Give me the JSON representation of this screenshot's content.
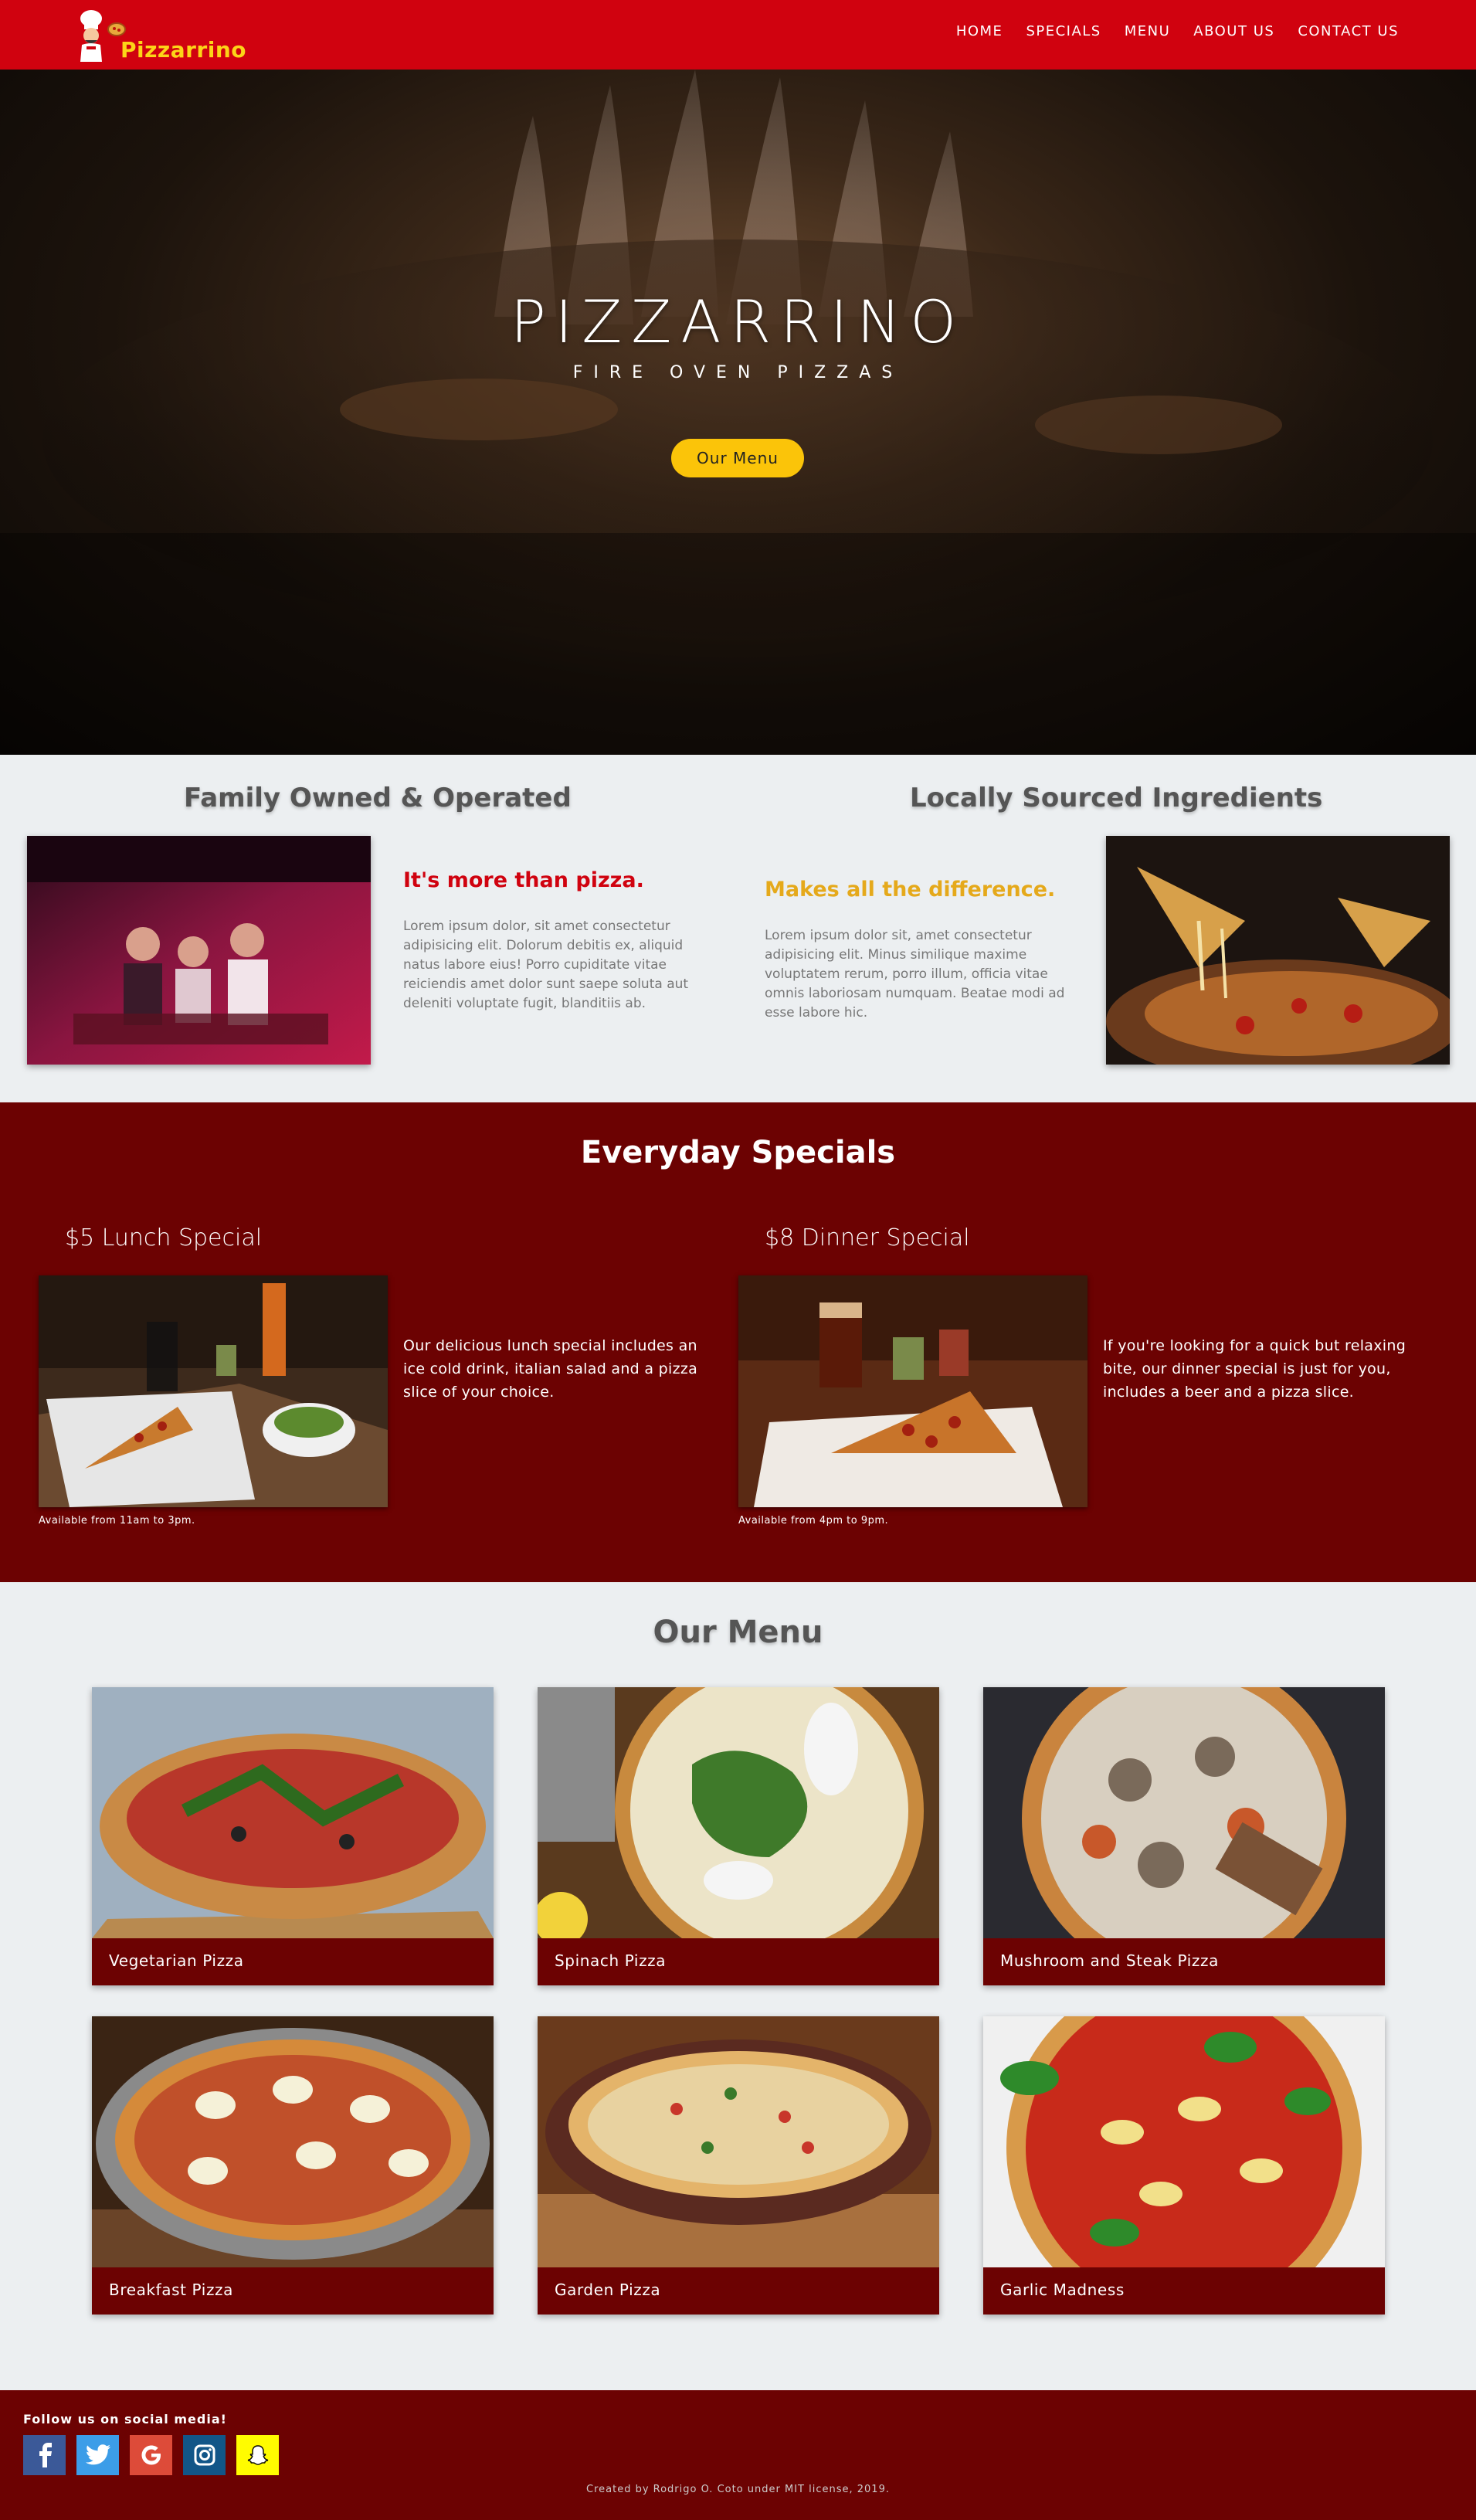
{
  "nav": {
    "brand": "Pizzarrino",
    "links": [
      "HOME",
      "SPECIALS",
      "MENU",
      "ABOUT US",
      "CONTACT US"
    ]
  },
  "hero": {
    "title": "PIZZARRINO",
    "subtitle": "FIRE OVEN PIZZAS",
    "button": "Our Menu"
  },
  "about": {
    "left": {
      "heading": "Family Owned & Operated",
      "tagline": "It's more than pizza.",
      "text": "Lorem ipsum dolor, sit amet consectetur adipisicing elit. Dolorum debitis ex, aliquid natus labore eius! Porro cupiditate vitae reiciendis amet dolor sunt saepe soluta aut deleniti voluptate fugit, blanditiis ab."
    },
    "right": {
      "heading": "Locally Sourced Ingredients",
      "tagline": "Makes all the difference.",
      "text": "Lorem ipsum dolor sit, amet consectetur adipisicing elit. Minus similique maxime voluptatem rerum, porro illum, officia vitae omnis laboriosam numquam. Beatae modi ad esse labore hic."
    }
  },
  "specials": {
    "heading": "Everyday Specials",
    "items": [
      {
        "title": "$5 Lunch Special",
        "desc": "Our delicious lunch special includes an ice cold drink, italian salad and a pizza slice of your choice.",
        "note": "Available from 11am to 3pm."
      },
      {
        "title": "$8 Dinner Special",
        "desc": "If you're looking for a quick but relaxing bite, our dinner special is just for you, includes a beer and a pizza slice.",
        "note": "Available from 4pm to 9pm."
      }
    ]
  },
  "menu": {
    "heading": "Our Menu",
    "items": [
      "Vegetarian Pizza",
      "Spinach Pizza",
      "Mushroom and Steak Pizza",
      "Breakfast Pizza",
      "Garden Pizza",
      "Garlic Madness"
    ]
  },
  "footer": {
    "follow": "Follow us on social media!",
    "socials": [
      "facebook-icon",
      "twitter-icon",
      "google-icon",
      "instagram-icon",
      "snapchat-icon"
    ],
    "credit": "Created by Rodrigo O. Coto under MIT license, 2019."
  },
  "colors": {
    "nav_red": "#d0020f",
    "brand_yellow": "#fcd418",
    "button_yellow": "#fbc409",
    "maroon": "#6c0202",
    "tag_red": "#d0020f",
    "tag_gold": "#e5a91b",
    "page_bg": "#eceff1"
  }
}
